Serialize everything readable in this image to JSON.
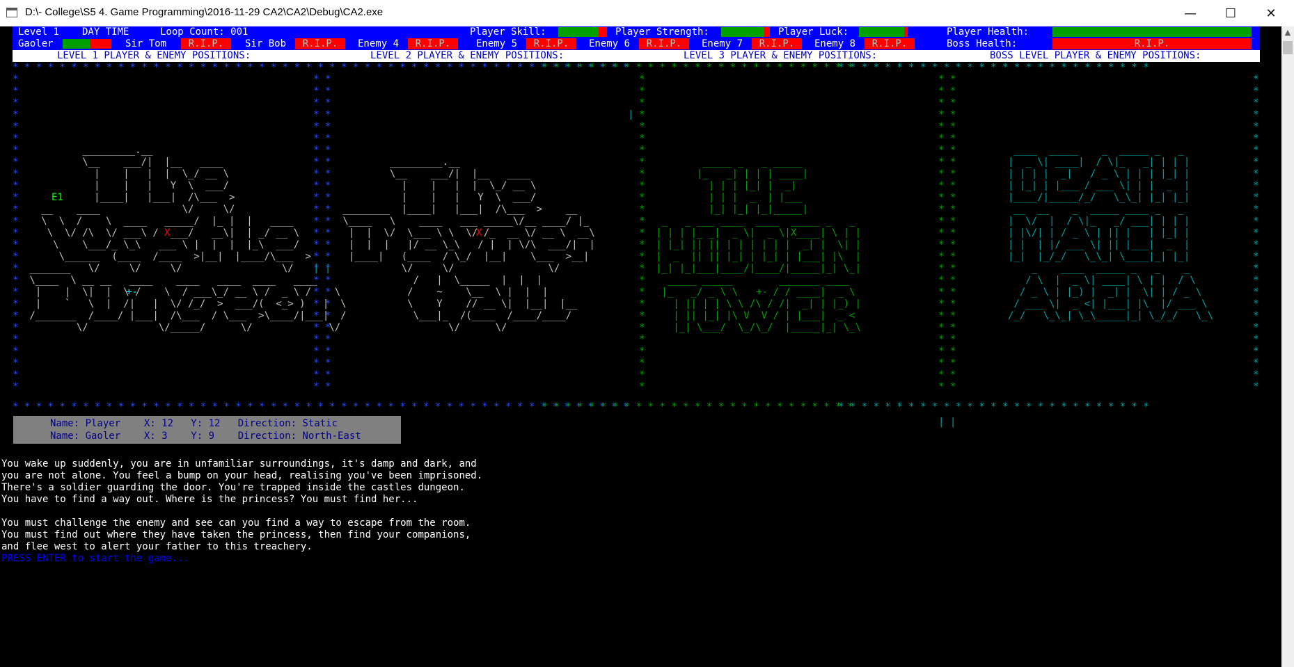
{
  "window": {
    "title": "D:\\- College\\S5 4. Game Programming\\2016-11-29 CA2\\CA2\\Debug\\CA2.exe",
    "min_glyph": "—",
    "max_glyph": "☐",
    "close_glyph": "✕"
  },
  "status": {
    "level": "Level 1",
    "time": "DAY TIME",
    "loop": "Loop Count: 001",
    "skill_label": "Player Skill:",
    "strength_label": "Player Strength:",
    "luck_label": "Player Luck:",
    "health_label": "Player Health:",
    "gaoler": "Gaoler",
    "sir_tom": "Sir Tom",
    "sir_bob": "Sir Bob",
    "enemy4": "Enemy 4",
    "enemy5": "Enemy 5",
    "enemy6": "Enemy 6",
    "enemy7": "Enemy 7",
    "enemy8": "Enemy 8",
    "boss_label": "Boss Health:",
    "rip": "R.I.P.",
    "player_skill_level": 0.83,
    "player_strength_level": 0.88,
    "player_luck_level": 0.93,
    "player_health_level": 1.0,
    "gaoler_health_level": 0.55
  },
  "levels": {
    "l1": "LEVEL 1 PLAYER & ENEMY POSITIONS:",
    "l2": "LEVEL 2 PLAYER & ENEMY POSITIONS:",
    "l3": "LEVEL 3 PLAYER & ENEMY POSITIONS:",
    "boss": "BOSS LEVEL PLAYER & ENEMY POSITIONS:"
  },
  "maps": {
    "dungeon_label_e1": "E1",
    "dungeon_x": "X",
    "dungeon_player": "+-",
    "tavern_x": "X",
    "tower_x": "X",
    "tower_player": "+-"
  },
  "info": {
    "player": "Name: Player    X: 12   Y: 12   Direction: Static",
    "gaoler": "Name: Gaoler    X: 3    Y: 9    Direction: North-East"
  },
  "story": {
    "p1": [
      "You wake up suddenly, you are in unfamiliar surroundings, it's damp and dark, and",
      "you are not alone. You feel a bump on your head, realising you've been imprisoned.",
      "There's a soldier guarding the door. You're trapped inside the castles dungeon.",
      "You have to find a way out. Where is the princess? You must find her..."
    ],
    "p2": [
      "You must challenge the enemy and see can you find a way to escape from the room.",
      "You must find out where they have taken the princess, then find your companions,",
      "and flee west to alert your father to this treachery."
    ],
    "prompt": "PRESS ENTER to start the game..."
  },
  "colors": {
    "status_bg": "#0000ff",
    "bar_green": "#00a000",
    "bar_red": "#ff0000",
    "console_bg": "#000000",
    "info_bg": "#808080"
  },
  "icons": [
    "app-icon",
    "minimize-icon",
    "maximize-icon",
    "close-icon",
    "scroll-up-icon"
  ]
}
